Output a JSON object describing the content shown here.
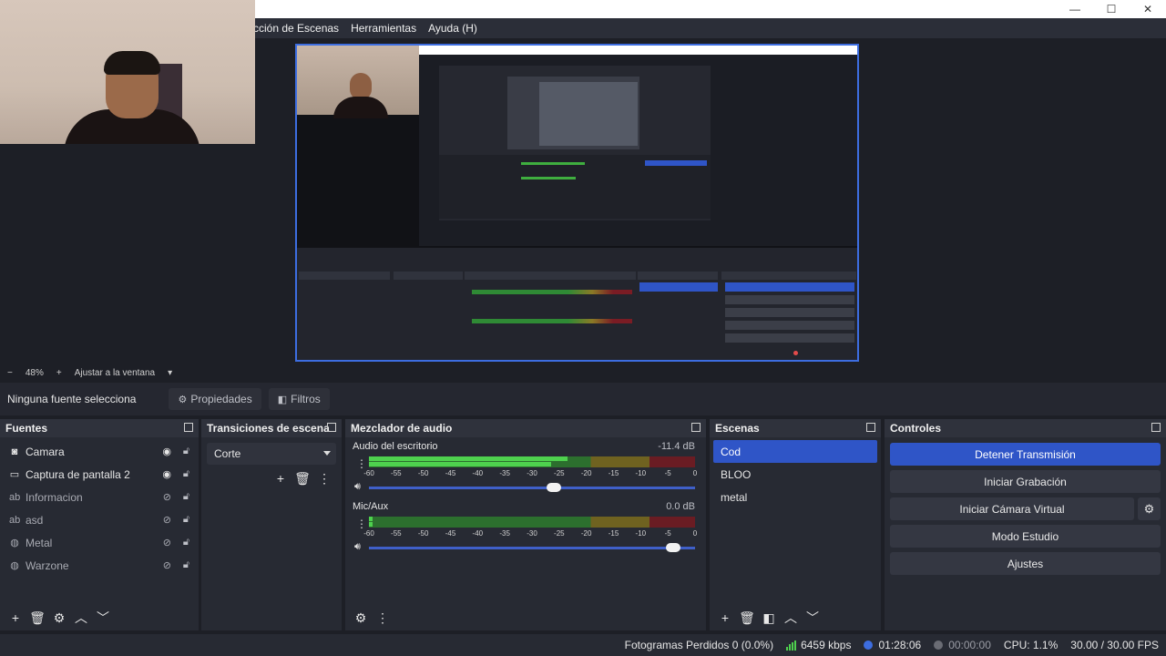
{
  "window": {
    "minimize": "—",
    "maximize": "☐",
    "close": "✕"
  },
  "menu": [
    "cción de Escenas",
    "Herramientas",
    "Ayuda (H)"
  ],
  "zoom": {
    "minus": "−",
    "level": "48%",
    "plus": "+",
    "fit": "Ajustar a la ventana"
  },
  "propbar": {
    "no_source": "Ninguna fuente selecciona",
    "properties": "Propiedades",
    "filters": "Filtros"
  },
  "sources": {
    "title": "Fuentes",
    "items": [
      {
        "icon": "camera-icon",
        "label": "Camara",
        "visible": true
      },
      {
        "icon": "monitor-icon",
        "label": "Captura de pantalla 2",
        "visible": true
      },
      {
        "icon": "text-icon",
        "label": "Informacion",
        "visible": false
      },
      {
        "icon": "text-icon",
        "label": "asd",
        "visible": false
      },
      {
        "icon": "gamepad-icon",
        "label": "Metal",
        "visible": false
      },
      {
        "icon": "gamepad-icon",
        "label": "Warzone",
        "visible": false
      }
    ]
  },
  "transitions": {
    "title": "Transiciones de escena",
    "selected": "Corte"
  },
  "mixer": {
    "title": "Mezclador de audio",
    "channels": [
      {
        "name": "Audio del escritorio",
        "db": "-11.4 dB",
        "level": 0.6,
        "volume": 0.7
      },
      {
        "name": "Mic/Aux",
        "db": "0.0 dB",
        "level": 0.0,
        "volume": 1.0
      }
    ],
    "ticks": [
      "-60",
      "-55",
      "-50",
      "-45",
      "-40",
      "-35",
      "-30",
      "-25",
      "-20",
      "-15",
      "-10",
      "-5",
      "0"
    ]
  },
  "scenes": {
    "title": "Escenas",
    "items": [
      "Cod",
      "BLOO",
      "metal"
    ],
    "active": 0
  },
  "controls": {
    "title": "Controles",
    "stop_stream": "Detener Transmisión",
    "start_record": "Iniciar Grabación",
    "virtual_cam": "Iniciar Cámara Virtual",
    "studio_mode": "Modo Estudio",
    "settings": "Ajustes"
  },
  "status": {
    "dropped": "Fotogramas Perdidos 0 (0.0%)",
    "kbps": "6459 kbps",
    "stream_time": "01:28:06",
    "record_time": "00:00:00",
    "cpu": "CPU: 1.1%",
    "fps": "30.00 / 30.00 FPS",
    "accent": "#2f55c7"
  }
}
